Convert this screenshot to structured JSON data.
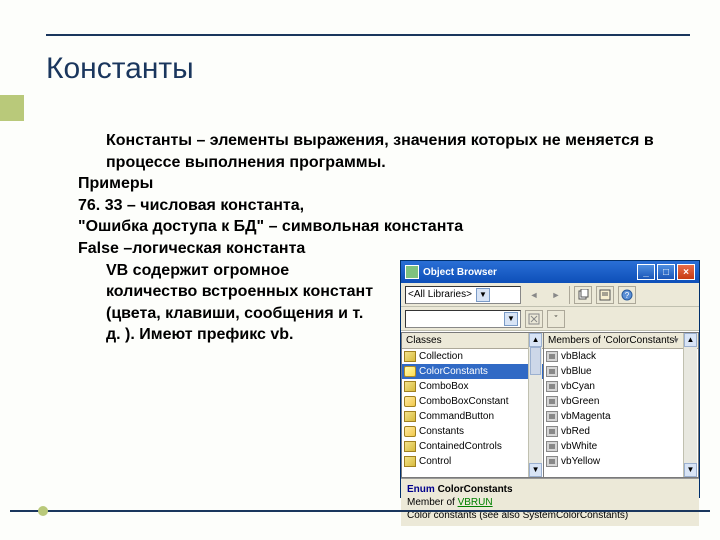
{
  "slide": {
    "title": "Константы",
    "line1": "Константы – элементы выражения, значения которых не меняется в процессе выполнения программы.",
    "line2": "Примеры",
    "line3": "76. 33 – числовая константа,",
    "line4": "\"Ошибка доступа к БД\" – символьная константа",
    "line5": "False –логическая константа",
    "line6": "VB содержит огромное количество встроенных констант (цвета, клавиши, сообщения и т. д. ). Имеют префикс vb."
  },
  "ob": {
    "title": "Object Browser",
    "win_min": "_",
    "win_max": "□",
    "win_close": "×",
    "combo_lib": "<All Libraries>",
    "combo_search": "",
    "arrow": "▼",
    "nav_back": "◄",
    "nav_fwd": "►",
    "left_arrow": "«",
    "right_arrow": "»",
    "head_classes": "Classes",
    "head_members": "Members of 'ColorConstants'",
    "classes": [
      {
        "icon": "class",
        "label": "Collection"
      },
      {
        "icon": "enum",
        "label": "ColorConstants",
        "sel": true
      },
      {
        "icon": "class",
        "label": "ComboBox"
      },
      {
        "icon": "enum",
        "label": "ComboBoxConstant"
      },
      {
        "icon": "class",
        "label": "CommandButton"
      },
      {
        "icon": "enum",
        "label": "Constants"
      },
      {
        "icon": "class",
        "label": "ContainedControls"
      },
      {
        "icon": "class",
        "label": "Control"
      }
    ],
    "members": [
      {
        "icon": "const",
        "label": "vbBlack"
      },
      {
        "icon": "const",
        "label": "vbBlue"
      },
      {
        "icon": "const",
        "label": "vbCyan"
      },
      {
        "icon": "const",
        "label": "vbGreen"
      },
      {
        "icon": "const",
        "label": "vbMagenta"
      },
      {
        "icon": "const",
        "label": "vbRed"
      },
      {
        "icon": "const",
        "label": "vbWhite"
      },
      {
        "icon": "const",
        "label": "vbYellow"
      }
    ],
    "bottom_enum_kw": "Enum",
    "bottom_enum_name": "ColorConstants",
    "bottom_member_of": "Member of",
    "bottom_member_link": "VBRUN",
    "bottom_desc": "Color constants (see also SystemColorConstants)"
  }
}
